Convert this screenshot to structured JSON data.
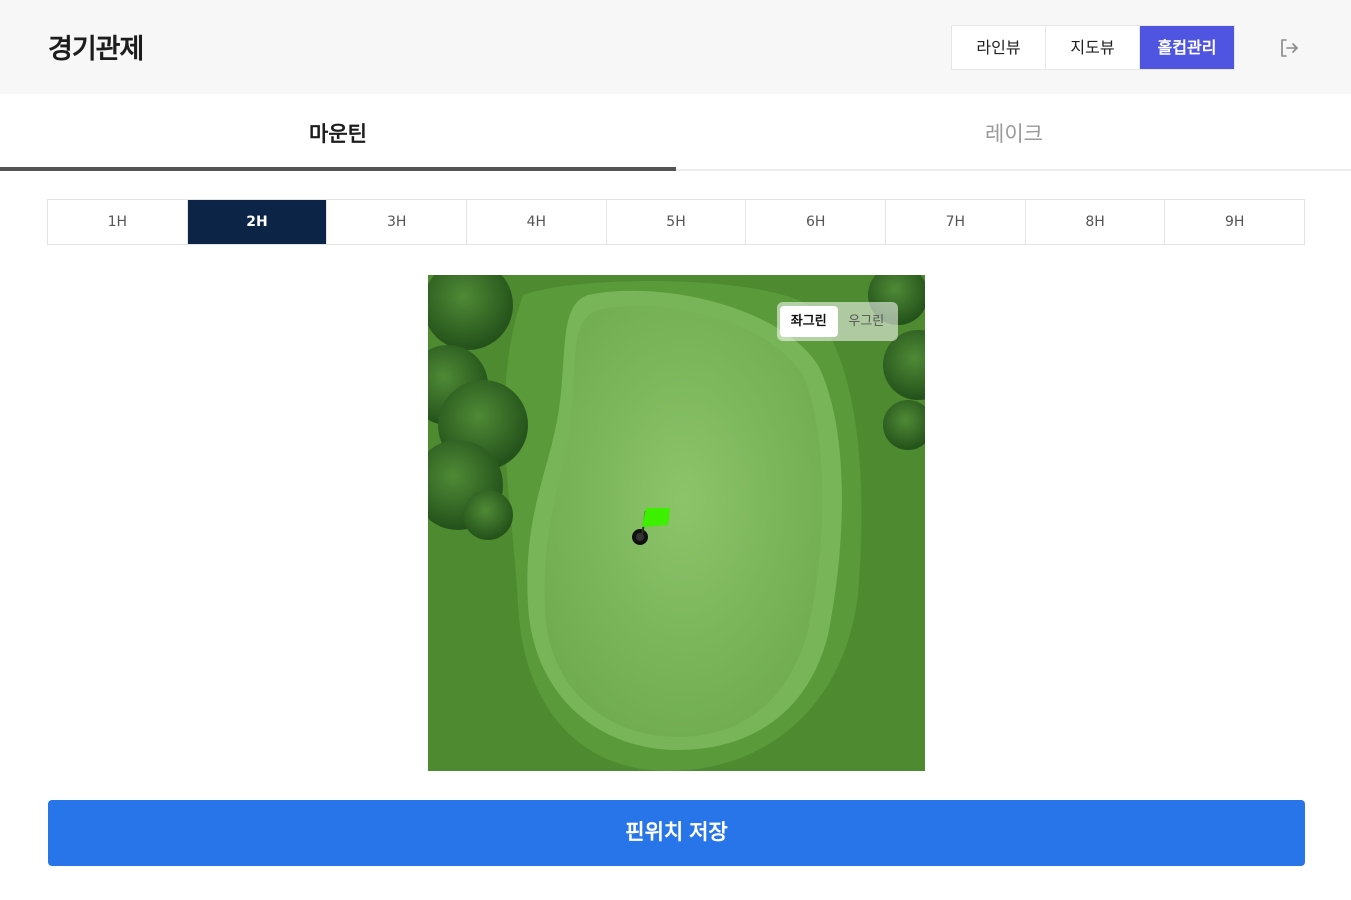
{
  "header": {
    "title": "경기관제",
    "views": [
      {
        "label": "라인뷰",
        "active": false
      },
      {
        "label": "지도뷰",
        "active": false
      },
      {
        "label": "홀컵관리",
        "active": true
      }
    ],
    "logout_icon": "logout-icon"
  },
  "course_tabs": [
    {
      "label": "마운틴",
      "active": true
    },
    {
      "label": "레이크",
      "active": false
    }
  ],
  "holes": [
    {
      "label": "1H",
      "active": false
    },
    {
      "label": "2H",
      "active": true
    },
    {
      "label": "3H",
      "active": false
    },
    {
      "label": "4H",
      "active": false
    },
    {
      "label": "5H",
      "active": false
    },
    {
      "label": "6H",
      "active": false
    },
    {
      "label": "7H",
      "active": false
    },
    {
      "label": "8H",
      "active": false
    },
    {
      "label": "9H",
      "active": false
    }
  ],
  "green_toggle": [
    {
      "label": "좌그린",
      "active": true
    },
    {
      "label": "우그린",
      "active": false
    }
  ],
  "map": {
    "pin_icon": "flag-icon",
    "cup_icon": "hole-cup-icon"
  },
  "colors": {
    "accent": "#4f55e0",
    "hole_active": "#0c2446",
    "save_button": "#2775e8",
    "flag": "#3cf000"
  },
  "save_button": "핀위치 저장"
}
